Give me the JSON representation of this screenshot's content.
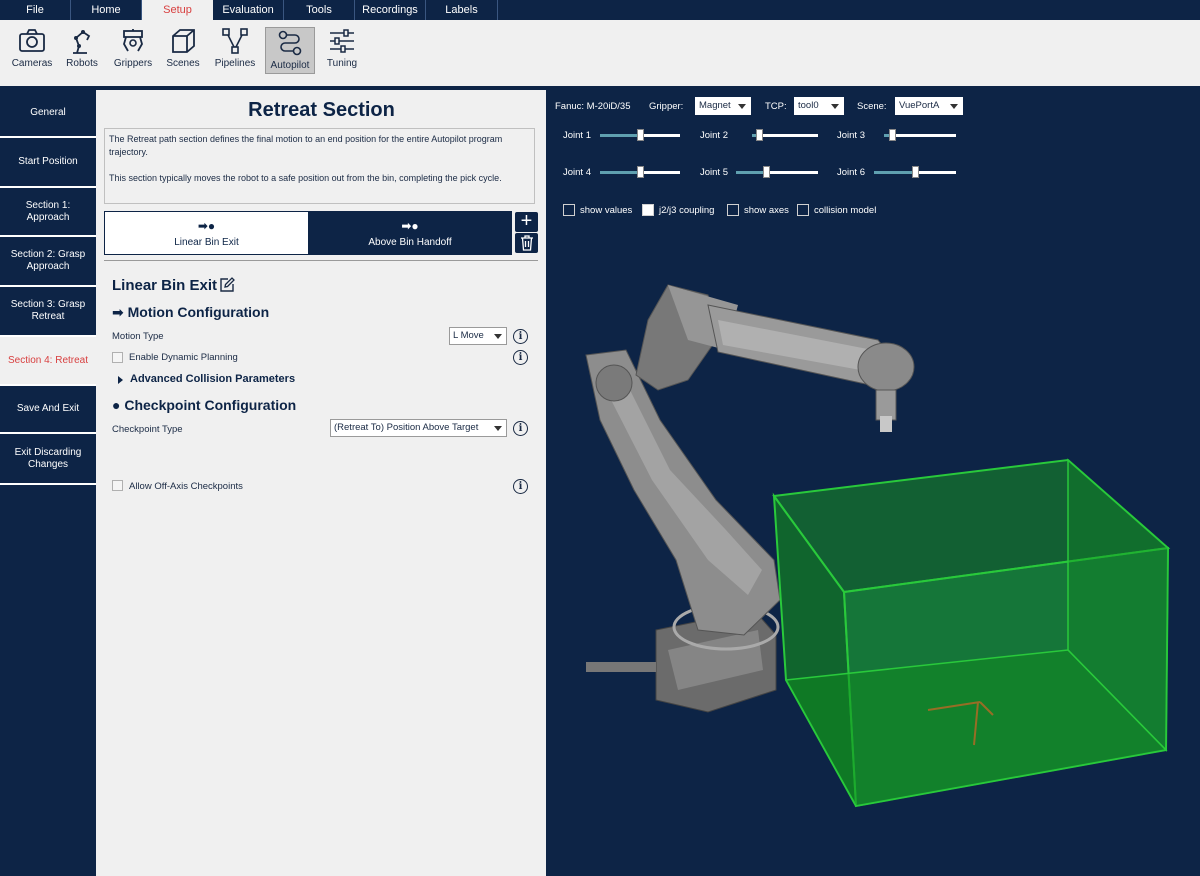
{
  "menu": {
    "tabs": [
      "File",
      "Home",
      "Setup",
      "Evaluation",
      "Tools",
      "Recordings",
      "Labels"
    ],
    "active": "Setup"
  },
  "toolbar": {
    "items": [
      {
        "label": "Cameras",
        "icon": "camera-icon"
      },
      {
        "label": "Robots",
        "icon": "robot-arm-icon"
      },
      {
        "label": "Grippers",
        "icon": "gripper-icon"
      },
      {
        "label": "Scenes",
        "icon": "cube-icon"
      },
      {
        "label": "Pipelines",
        "icon": "pipeline-icon"
      },
      {
        "label": "Autopilot",
        "icon": "autopilot-icon"
      },
      {
        "label": "Tuning",
        "icon": "sliders-icon"
      }
    ],
    "active": "Autopilot"
  },
  "nav": {
    "items": [
      {
        "label": "General"
      },
      {
        "label": "Start Position"
      },
      {
        "label": "Section 1: Approach"
      },
      {
        "label": "Section 2: Grasp Approach"
      },
      {
        "label": "Section 3: Grasp Retreat"
      },
      {
        "label": "Section 4: Retreat"
      },
      {
        "label": "Save And Exit"
      },
      {
        "label": "Exit Discarding Changes"
      }
    ],
    "active": "Section 4: Retreat"
  },
  "panel": {
    "title": "Retreat Section",
    "description_1": "The Retreat path section defines the final motion to an end position for the entire Autopilot program trajectory.",
    "description_2": "This section typically moves the robot to a safe position out from the bin, completing the pick cycle.",
    "segments": [
      {
        "label": "Linear Bin Exit",
        "glyph": "➡●"
      },
      {
        "label": "Above Bin Handoff",
        "glyph": "➡●"
      }
    ],
    "active_segment": "Linear Bin Exit",
    "segment_name": "Linear Bin Exit",
    "motion_heading": "➡ Motion Configuration",
    "motion_type_label": "Motion Type",
    "motion_type_value": "L Move",
    "dynamic_planning_label": "Enable Dynamic Planning",
    "dynamic_planning_checked": false,
    "advanced_label": "Advanced Collision Parameters",
    "checkpoint_heading": "● Checkpoint Configuration",
    "checkpoint_type_label": "Checkpoint Type",
    "checkpoint_type_value": "(Retreat To) Position Above Target",
    "off_axis_label": "Allow Off-Axis Checkpoints",
    "off_axis_checked": false,
    "info_glyph": "i",
    "add_glyph": "+"
  },
  "viewport": {
    "robot_label": "Fanuc: M-20iD/35",
    "gripper_label": "Gripper:",
    "gripper_value": "Magnet",
    "tcp_label": "TCP:",
    "tcp_value": "tool0",
    "scene_label": "Scene:",
    "scene_value": "VuePortA",
    "joints": [
      {
        "label": "Joint 1",
        "value": 0.5
      },
      {
        "label": "Joint 2",
        "value": 0.07
      },
      {
        "label": "Joint 3",
        "value": 0.07
      },
      {
        "label": "Joint 4",
        "value": 0.5
      },
      {
        "label": "Joint 5",
        "value": 0.36
      },
      {
        "label": "Joint 6",
        "value": 0.5
      }
    ],
    "options": [
      {
        "label": "show values",
        "checked": false
      },
      {
        "label": "j2/j3 coupling",
        "checked": true
      },
      {
        "label": "show axes",
        "checked": false
      },
      {
        "label": "collision model",
        "checked": false
      }
    ],
    "colors": {
      "background": "#0d2446",
      "bin": "#1fd62a",
      "robot": "#8a8a8a",
      "accent": "#d84040"
    }
  }
}
